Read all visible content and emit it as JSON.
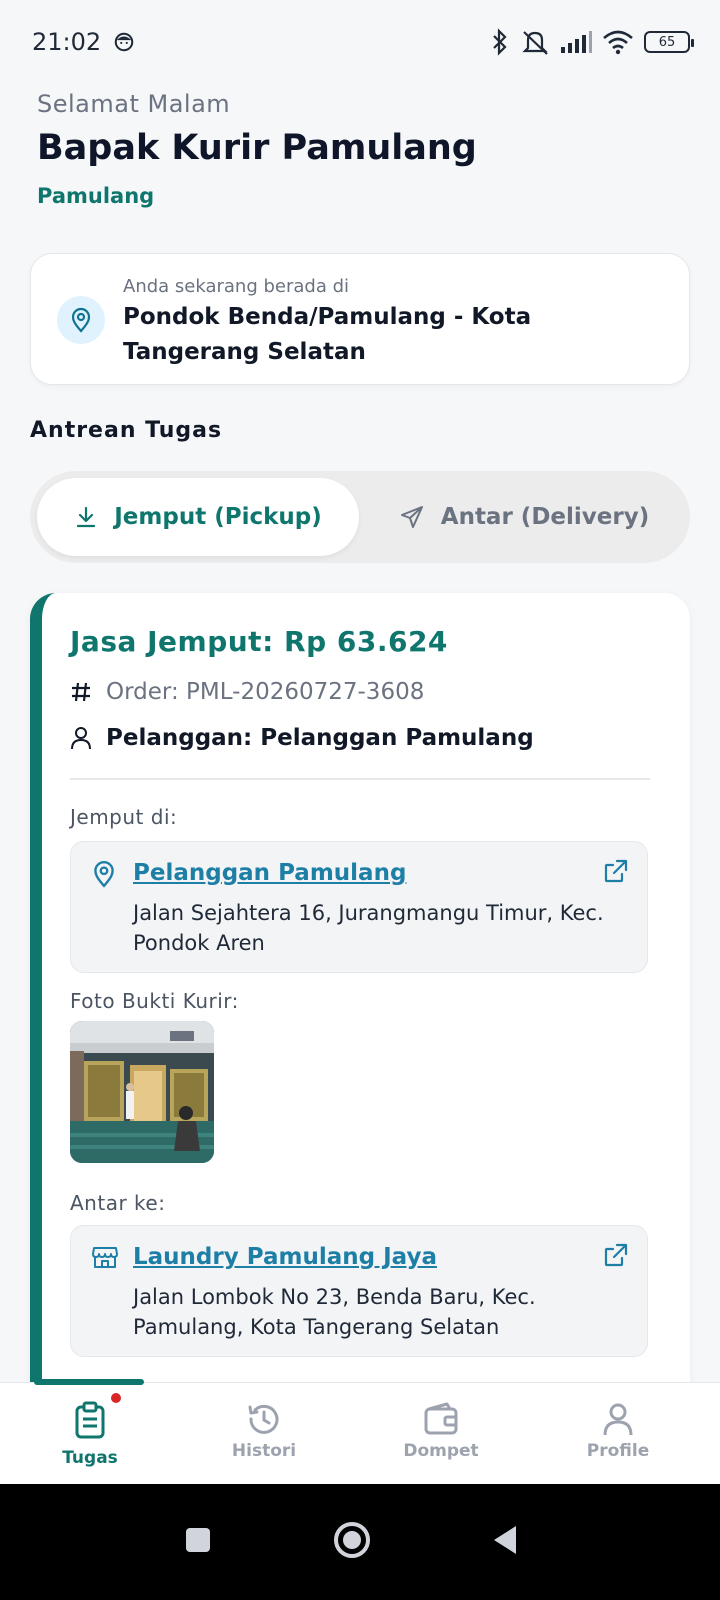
{
  "status_bar": {
    "time": "21:02",
    "battery": "65"
  },
  "header": {
    "greeting": "Selamat Malam",
    "name": "Bapak Kurir Pamulang",
    "city": "Pamulang"
  },
  "location": {
    "label": "Anda sekarang berada di",
    "value": "Pondok Benda/Pamulang - Kota Tangerang Selatan"
  },
  "section_title": "Antrean Tugas",
  "tabs": [
    {
      "label": "Jemput (Pickup)",
      "icon": "download-icon",
      "active": true
    },
    {
      "label": "Antar (Delivery)",
      "icon": "send-icon",
      "active": false
    }
  ],
  "task": {
    "price": "Jasa Jemput: Rp 63.624",
    "order": "Order: PML-20260727-3608",
    "customer": "Pelanggan: Pelanggan Pamulang",
    "pickup_label": "Jemput di:",
    "pickup_name": "Pelanggan Pamulang",
    "pickup_address": "Jalan Sejahtera 16, Jurangmangu Timur, Kec. Pondok Aren",
    "photo_label": "Foto Bukti Kurir:",
    "dropoff_label": "Antar ke:",
    "dropoff_name": "Laundry Pamulang Jaya",
    "dropoff_address": "Jalan Lombok No 23, Benda Baru, Kec. Pamulang, Kota Tangerang Selatan"
  },
  "bottom_nav": [
    {
      "label": "Tugas",
      "icon": "clipboard-icon",
      "active": true,
      "badge": true
    },
    {
      "label": "Histori",
      "icon": "history-icon",
      "active": false
    },
    {
      "label": "Dompet",
      "icon": "wallet-icon",
      "active": false
    },
    {
      "label": "Profile",
      "icon": "user-icon",
      "active": false
    }
  ],
  "colors": {
    "accent": "#0f766e",
    "link": "#1d7fa6",
    "badge": "#dc2626"
  }
}
